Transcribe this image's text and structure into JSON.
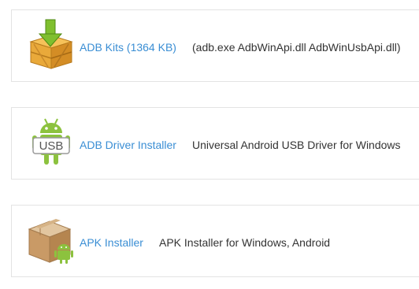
{
  "items": [
    {
      "icon": "wooden-crate-download-icon",
      "link_label": "ADB Kits (1364 KB)",
      "description": "(adb.exe AdbWinApi.dll AdbWinUsbApi.dll)"
    },
    {
      "icon": "android-usb-icon",
      "link_label": "ADB Driver Installer",
      "description": "Universal Android USB Driver for Windows",
      "badge_text": "USB"
    },
    {
      "icon": "package-box-android-icon",
      "link_label": "APK Installer",
      "description": "APK Installer for Windows, Android"
    }
  ],
  "colors": {
    "link": "#3a8ed4",
    "text": "#333333",
    "border": "#e3e3e3",
    "android_green": "#8cc23e"
  }
}
